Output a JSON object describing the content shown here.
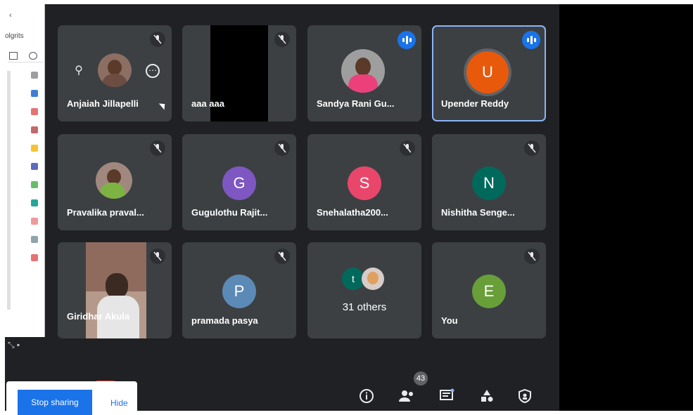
{
  "background_app": {
    "title_fragment": "olgrits"
  },
  "tiles": [
    {
      "name": "Anjaiah Jillapelli",
      "type": "photo",
      "avatar_color": "#6d4c41"
    },
    {
      "name": "aaa aaa",
      "type": "black-video"
    },
    {
      "name": "Sandya Rani Gu...",
      "type": "photo",
      "avatar_color": "#ec407a"
    },
    {
      "name": "Upender Reddy",
      "type": "letter",
      "initial": "U",
      "avatar_color": "#e8590c",
      "active": true
    },
    {
      "name": "Pravalika praval...",
      "type": "photo",
      "avatar_color": "#7cb342"
    },
    {
      "name": "Gugulothu Rajit...",
      "type": "letter",
      "initial": "G",
      "avatar_color": "#7e57c2"
    },
    {
      "name": "Snehalatha200...",
      "type": "letter",
      "initial": "S",
      "avatar_color": "#e8476b"
    },
    {
      "name": "Nishitha Senge...",
      "type": "letter",
      "initial": "N",
      "avatar_color": "#00695c"
    },
    {
      "name": "Giridhar Akula",
      "type": "person-video"
    },
    {
      "name": "pramada pasya",
      "type": "letter",
      "initial": "P",
      "avatar_color": "#5c8ab6"
    },
    {
      "name": "31 others",
      "type": "others",
      "mini_initial": "t"
    },
    {
      "name": "You",
      "type": "letter",
      "initial": "E",
      "avatar_color": "#689f38"
    }
  ],
  "controls": {
    "stop_sharing_label": "Stop sharing",
    "hide_label": "Hide",
    "participants_count": "43",
    "info_icon": "info-icon",
    "people_icon": "people-icon",
    "chat_icon": "chat-icon",
    "activities_icon": "activities-icon",
    "host_controls_icon": "shield-icon"
  },
  "colors": {
    "meet_background": "#202124",
    "tile_background": "#3c4043",
    "active_border": "#8ab4f8",
    "accent_blue": "#1a73e8",
    "end_call_red": "#ea4335"
  }
}
